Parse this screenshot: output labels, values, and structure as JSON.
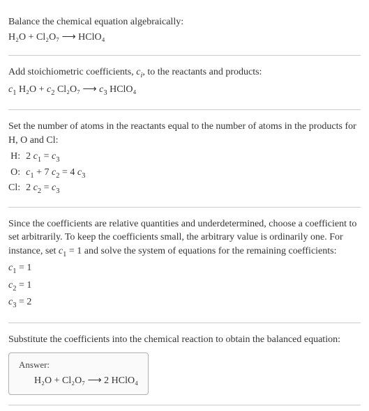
{
  "section1": {
    "intro": "Balance the chemical equation algebraically:",
    "equation": "H₂O + Cl₂O₇ ⟶ HClO₄"
  },
  "section2": {
    "intro_a": "Add stoichiometric coefficients, ",
    "intro_ci": "c",
    "intro_ci_sub": "i",
    "intro_b": ", to the reactants and products:",
    "eq_parts": {
      "c1": "c",
      "c1sub": "1",
      "h2o": " H₂O + ",
      "c2": "c",
      "c2sub": "2",
      "cl2o7": " Cl₂O₇ ⟶ ",
      "c3": "c",
      "c3sub": "3",
      "hclo4": " HClO₄"
    }
  },
  "section3": {
    "intro": "Set the number of atoms in the reactants equal to the number of atoms in the products for H, O and Cl:",
    "rows": {
      "h_label": "H: ",
      "h_eq_a": "2 ",
      "h_c1": "c",
      "h_c1s": "1",
      "h_mid": " = ",
      "h_c3": "c",
      "h_c3s": "3",
      "o_label": "O: ",
      "o_c1": "c",
      "o_c1s": "1",
      "o_plus": " + 7 ",
      "o_c2": "c",
      "o_c2s": "2",
      "o_mid": " = 4 ",
      "o_c3": "c",
      "o_c3s": "3",
      "cl_label": "Cl: ",
      "cl_a": "2 ",
      "cl_c2": "c",
      "cl_c2s": "2",
      "cl_mid": " = ",
      "cl_c3": "c",
      "cl_c3s": "3"
    }
  },
  "section4": {
    "intro_a": "Since the coefficients are relative quantities and underdetermined, choose a coefficient to set arbitrarily. To keep the coefficients small, the arbitrary value is ordinarily one. For instance, set ",
    "c1": "c",
    "c1s": "1",
    "intro_b": " = 1 and solve the system of equations for the remaining coefficients:",
    "r1_c": "c",
    "r1_s": "1",
    "r1_v": " = 1",
    "r2_c": "c",
    "r2_s": "2",
    "r2_v": " = 1",
    "r3_c": "c",
    "r3_s": "3",
    "r3_v": " = 2"
  },
  "section5": {
    "intro": "Substitute the coefficients into the chemical reaction to obtain the balanced equation:",
    "answer_label": "Answer:",
    "answer_eq": "H₂O + Cl₂O₇ ⟶ 2 HClO₄"
  }
}
